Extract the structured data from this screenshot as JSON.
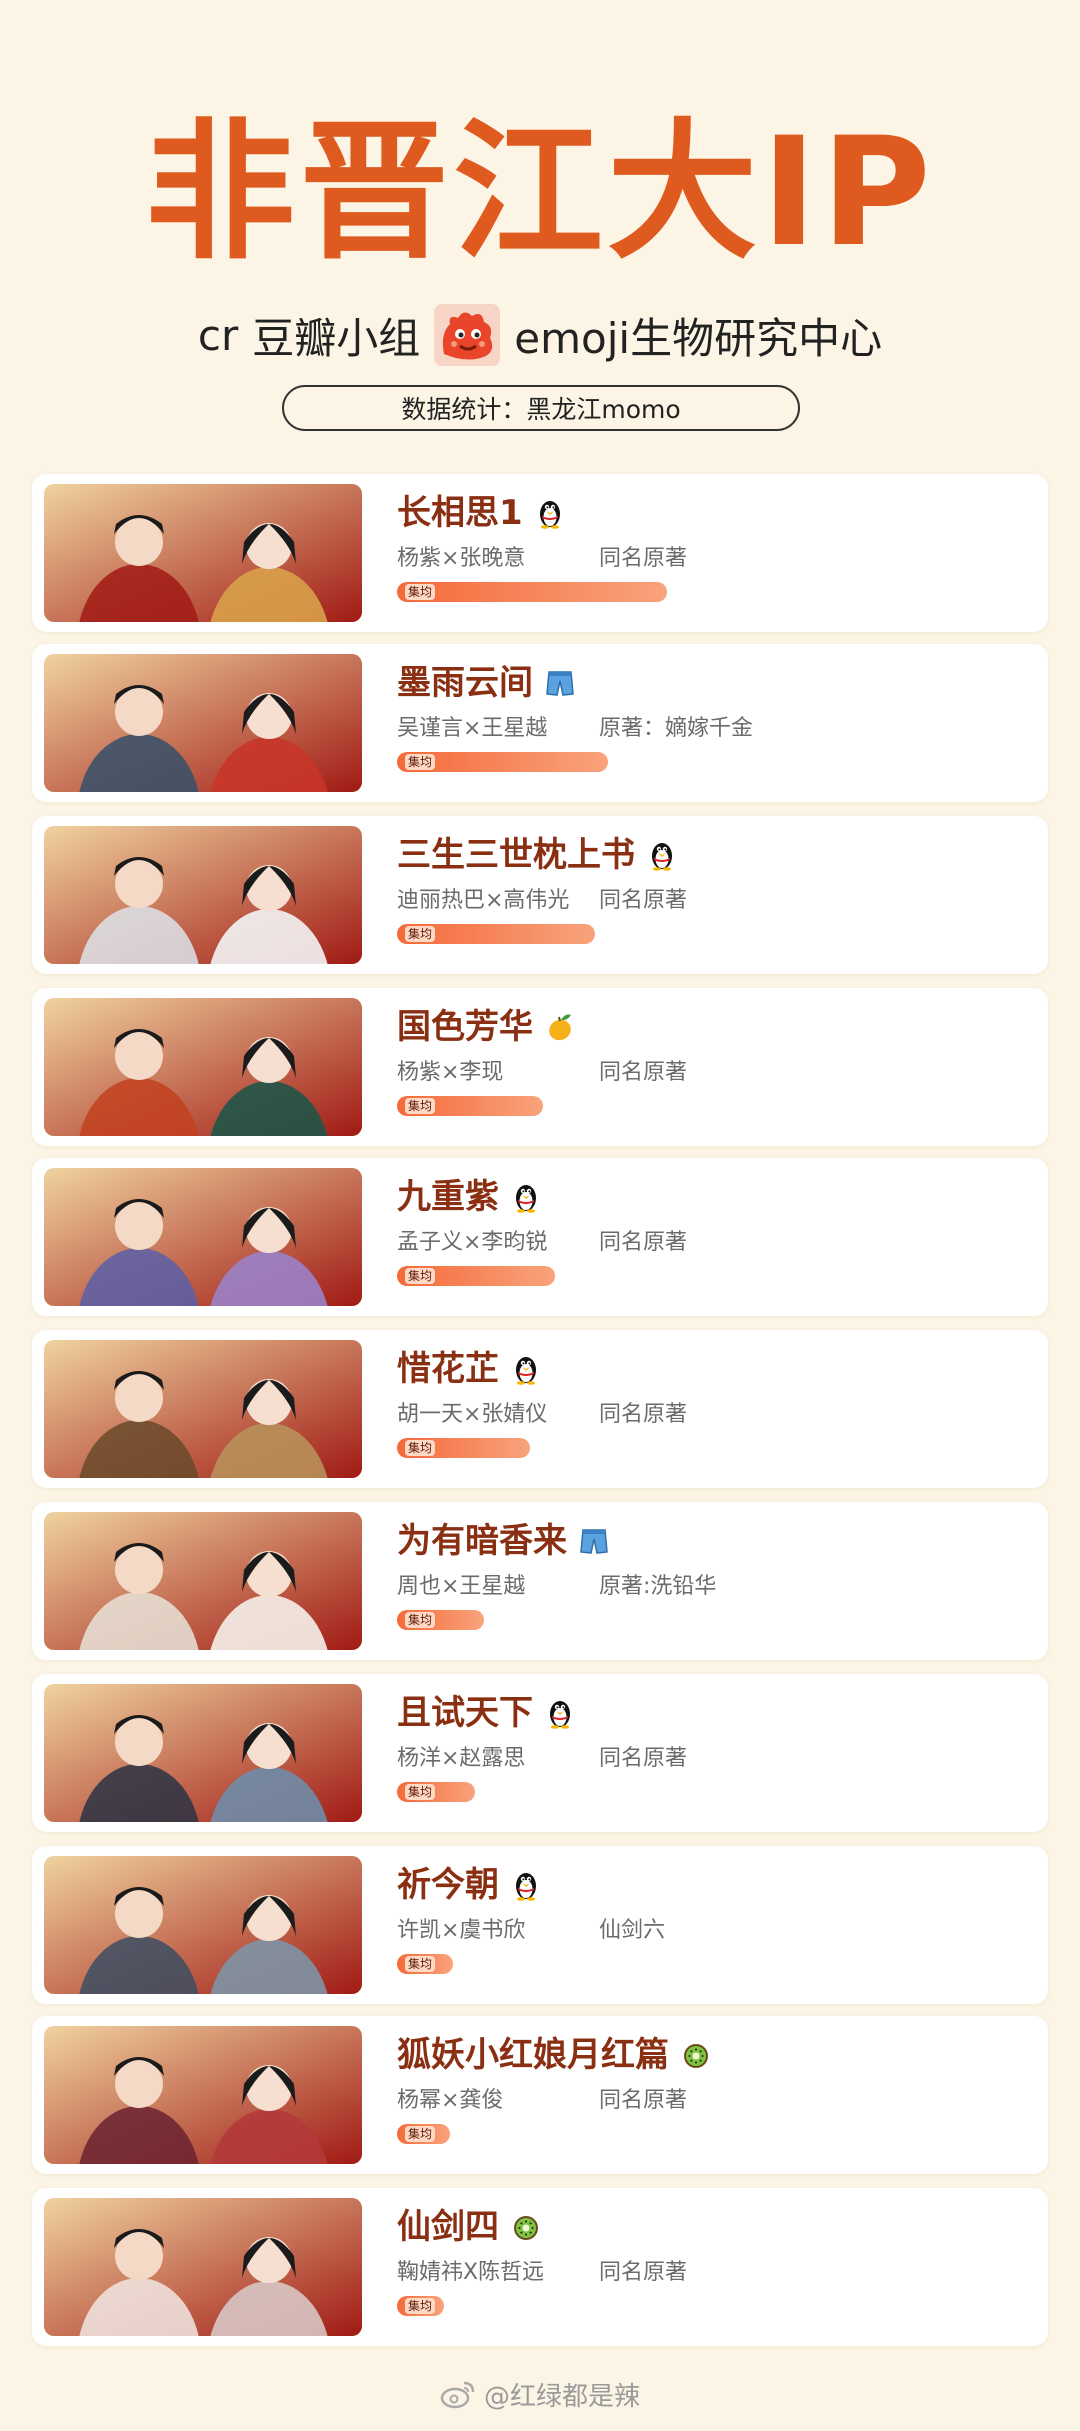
{
  "header": {
    "title": "非晋江大IP",
    "credit_prefix": "cr",
    "credit_group": "豆瓣小组",
    "credit_suffix": "emoji生物研究中心",
    "stats": "数据统计：黑龙江momo"
  },
  "progress_label": "集均",
  "items": [
    {
      "title": "长相思1",
      "platform_icon": "penguin-icon",
      "cast": "杨紫×张晚意",
      "source": "同名原著",
      "progress": 0.87
    },
    {
      "title": "墨雨云间",
      "platform_icon": "shorts-icon",
      "cast": "吴谨言×王星越",
      "source": "原著：嫡嫁千金",
      "progress": 0.68
    },
    {
      "title": "三生三世枕上书",
      "platform_icon": "penguin-icon",
      "cast": "迪丽热巴×高伟光",
      "source": "同名原著",
      "progress": 0.64
    },
    {
      "title": "国色芳华",
      "platform_icon": "mango-icon",
      "cast": "杨紫×李现",
      "source": "同名原著",
      "progress": 0.47
    },
    {
      "title": "九重紫",
      "platform_icon": "penguin-icon",
      "cast": "孟子义×李昀锐",
      "source": "同名原著",
      "progress": 0.51
    },
    {
      "title": "惜花芷",
      "platform_icon": "penguin-icon",
      "cast": "胡一天×张婧仪",
      "source": "同名原著",
      "progress": 0.43
    },
    {
      "title": "为有暗香来",
      "platform_icon": "shorts-icon",
      "cast": "周也×王星越",
      "source": "原著:洗铅华",
      "progress": 0.28
    },
    {
      "title": "且试天下",
      "platform_icon": "penguin-icon",
      "cast": "杨洋×赵露思",
      "source": "同名原著",
      "progress": 0.25
    },
    {
      "title": "祈今朝",
      "platform_icon": "penguin-icon",
      "cast": "许凯×虞书欣",
      "source": "仙剑六",
      "progress": 0.18
    },
    {
      "title": "狐妖小红娘月红篇",
      "platform_icon": "kiwi-icon",
      "cast": "杨幂×龚俊",
      "source": "同名原著",
      "progress": 0.17
    },
    {
      "title": "仙剑四",
      "platform_icon": "kiwi-icon",
      "cast": "鞠婧祎X陈哲远",
      "source": "同名原著",
      "progress": 0.15
    }
  ],
  "watermark": "@红绿都是辣"
}
